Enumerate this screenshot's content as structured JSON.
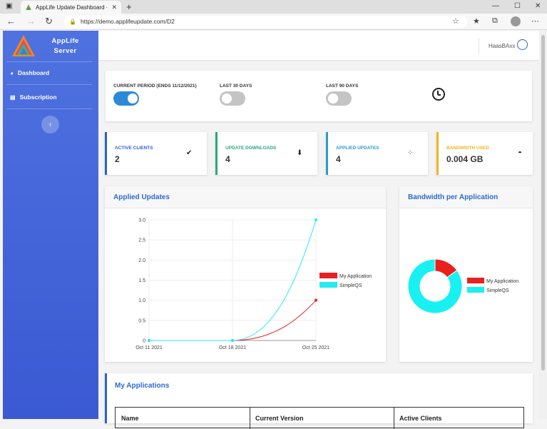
{
  "browser": {
    "tab_title": "AppLife Update Dashboard - Haa",
    "url": "https://demo.applifeupdate.com/D2"
  },
  "sidebar": {
    "brand_line1": "AppLife",
    "brand_line2": "Server",
    "items": [
      {
        "label": "Dashboard",
        "icon": "gauge-icon"
      },
      {
        "label": "Subscription",
        "icon": "document-icon"
      }
    ]
  },
  "header": {
    "username": "HaasBAxx"
  },
  "period": {
    "options": [
      {
        "label": "CURRENT PERIOD (ENDS 11/12/2021)",
        "on": true
      },
      {
        "label": "LAST 30 DAYS",
        "on": false
      },
      {
        "label": "LAST 90 DAYS",
        "on": false
      }
    ]
  },
  "stats": [
    {
      "label": "ACTIVE CLIENTS",
      "value": "2",
      "color": "#2c5fd6",
      "icon": "double-check-icon"
    },
    {
      "label": "UPDATE DOWNLOADS",
      "value": "4",
      "color": "#2aa87e",
      "icon": "download-icon"
    },
    {
      "label": "APPLIED UPDATES",
      "value": "4",
      "color": "#2c9bc9",
      "icon": "spinner-icon"
    },
    {
      "label": "BANDWIDTH USED",
      "value": "0.004 GB",
      "color": "#f2b320",
      "icon": "speedometer-icon"
    }
  ],
  "applied_updates": {
    "title": "Applied Updates",
    "chart_data": {
      "type": "line",
      "x": [
        "Oct 11 2021",
        "Oct 18 2021",
        "Oct 25 2021"
      ],
      "y_ticks": [
        "0",
        "0.5",
        "1.0",
        "1.5",
        "2.0",
        "2.5",
        "3.0"
      ],
      "ylim": [
        0,
        3
      ],
      "series": [
        {
          "name": "My Application",
          "values": [
            0,
            0,
            1
          ],
          "color": "#e8201e"
        },
        {
          "name": "SimpleQS",
          "values": [
            0,
            0,
            3
          ],
          "color": "#26eaf0"
        }
      ]
    }
  },
  "bandwidth": {
    "title": "Bandwidth per Application",
    "chart_data": {
      "type": "pie",
      "labels": [
        "My Application",
        "SimpleQS"
      ],
      "values": [
        15,
        85
      ],
      "colors": [
        "#e8201e",
        "#18f0f2"
      ]
    }
  },
  "apps": {
    "title": "My Applications",
    "columns": [
      "Name",
      "Current Version",
      "Active Clients"
    ]
  }
}
